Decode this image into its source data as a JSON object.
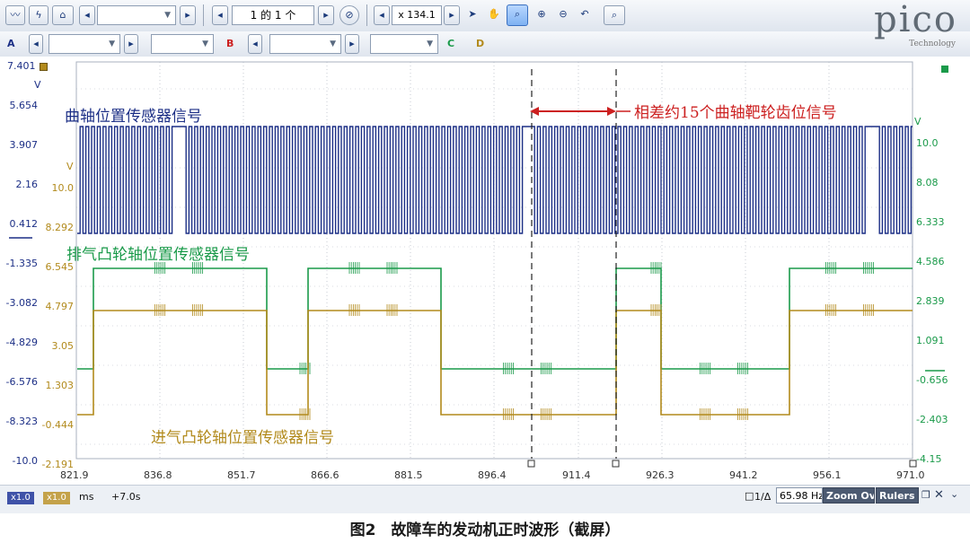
{
  "toolbar": {
    "page_field": "1 的 1 个",
    "zoom_field": "x 134.1",
    "channel_a": "A",
    "channel_b": "B",
    "channel_c": "C",
    "channel_d": "D",
    "logo_text": "pico",
    "logo_sub": "Technology"
  },
  "plot": {
    "top_value": "7.401",
    "left_unit": "V",
    "b_unit": "V",
    "c_unit": "V",
    "left_ticks": [
      "5.654",
      "3.907",
      "2.16",
      "0.412",
      "-1.335",
      "-3.082",
      "-4.829",
      "-6.576",
      "-8.323",
      "-10.0"
    ],
    "b_ticks": [
      "10.0",
      "8.292",
      "6.545",
      "4.797",
      "3.05",
      "1.303",
      "-0.444",
      "-2.191"
    ],
    "right_ticks": [
      "10.0",
      "8.08",
      "6.333",
      "4.586",
      "2.839",
      "1.091",
      "-0.656",
      "-2.403",
      "-4.15"
    ],
    "x_ticks": [
      "821.9",
      "836.8",
      "851.7",
      "866.6",
      "881.5",
      "896.4",
      "911.4",
      "926.3",
      "941.2",
      "956.1",
      "971.0"
    ],
    "label_crank": "曲轴位置传感器信号",
    "label_exhaust": "排气凸轮轴位置传感器信号",
    "label_intake": "进气凸轮轴位置传感器信号",
    "annotation": "相差约15个曲轴靶轮齿位信号",
    "colors": {
      "a": "#1c2f86",
      "b": "#b28a1c",
      "c": "#1a9a4a",
      "annotation": "#cc1f1f"
    }
  },
  "status": {
    "x_a": "x1.0",
    "x_b": "x1.0",
    "unit": "ms",
    "offset": "+7.0s",
    "ruler_label": "1/Δ",
    "freq": "65.98 Hz",
    "zoom_tab": "Zoom Ov",
    "rulers_tab": "Rulers"
  },
  "caption": "图2　故障车的发动机正时波形（截屏）"
}
